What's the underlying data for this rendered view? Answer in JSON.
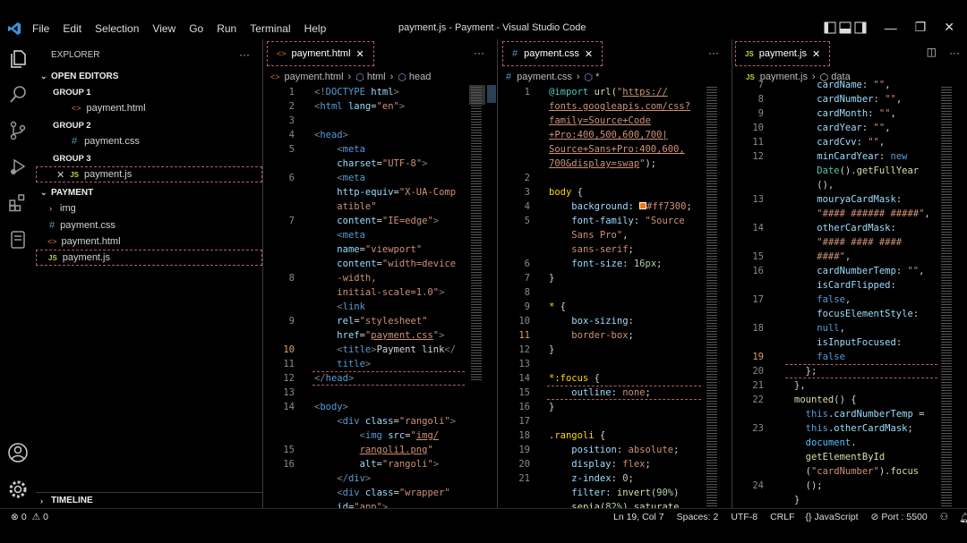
{
  "menu": [
    "File",
    "Edit",
    "Selection",
    "View",
    "Go",
    "Run",
    "Terminal",
    "Help"
  ],
  "window_title": "payment.js - Payment - Visual Studio Code",
  "sidebar": {
    "title": "EXPLORER",
    "open_editors": "OPEN EDITORS",
    "groups": [
      {
        "label": "GROUP 1",
        "file": "payment.html",
        "icon": "<>"
      },
      {
        "label": "GROUP 2",
        "file": "payment.css",
        "icon": "#"
      },
      {
        "label": "GROUP 3",
        "file": "payment.js",
        "icon": "JS"
      }
    ],
    "folder": "PAYMENT",
    "items": [
      {
        "label": "img",
        "kind": "folder"
      },
      {
        "label": "payment.css",
        "icon": "#"
      },
      {
        "label": "payment.html",
        "icon": "<>"
      },
      {
        "label": "payment.js",
        "icon": "JS"
      }
    ],
    "timeline": "TIMELINE"
  },
  "panes": [
    {
      "tab": "payment.html",
      "icon": "<>",
      "crumbs": [
        "payment.html",
        "html",
        "head"
      ]
    },
    {
      "tab": "payment.css",
      "icon": "#",
      "crumbs": [
        "payment.css",
        "*"
      ]
    },
    {
      "tab": "payment.js",
      "icon": "JS",
      "crumbs": [
        "payment.js",
        "data"
      ]
    }
  ],
  "status": {
    "errors": "0",
    "warnings": "0",
    "position": "Ln 19, Col 7",
    "spaces": "Spaces: 2",
    "encoding": "UTF-8",
    "eol": "CRLF",
    "language": "JavaScript",
    "port": "Port : 5500"
  },
  "colors": {
    "accent": "#3a96dd",
    "orange_swatch": "#ff7300",
    "dashed_border": "#b0625f"
  }
}
